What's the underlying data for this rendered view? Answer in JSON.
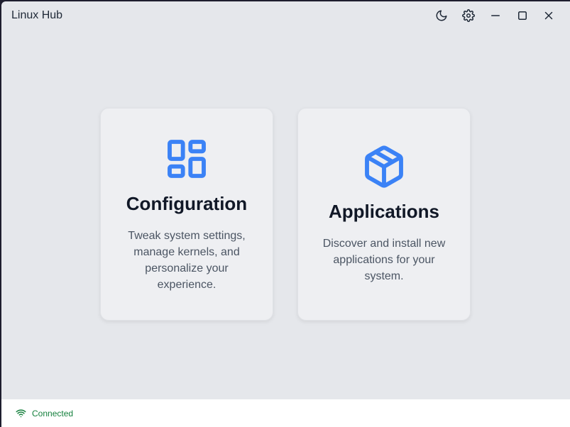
{
  "window": {
    "title": "Linux Hub",
    "controls": {
      "theme_icon": "moon-icon",
      "settings_icon": "gear-icon",
      "minimize_icon": "minimize-icon",
      "maximize_icon": "maximize-icon",
      "close_icon": "close-icon"
    }
  },
  "cards": [
    {
      "icon": "layout-grid-icon",
      "title": "Configuration",
      "description": "Tweak system settings, manage kernels, and personalize your experience."
    },
    {
      "icon": "package-icon",
      "title": "Applications",
      "description": "Discover and install new applications for your system."
    }
  ],
  "status": {
    "icon": "wifi-icon",
    "text": "Connected",
    "color": "#15803d"
  },
  "colors": {
    "accent": "#3b82f6",
    "background": "#e5e7eb",
    "card": "#eeeff2"
  }
}
